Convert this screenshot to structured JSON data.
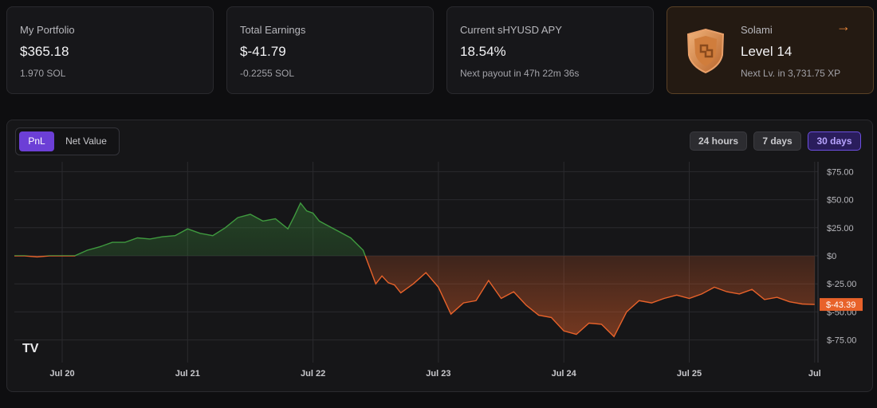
{
  "cards": {
    "portfolio": {
      "label": "My Portfolio",
      "value": "$365.18",
      "sub": "1.970 SOL"
    },
    "earnings": {
      "label": "Total Earnings",
      "value": "$-41.79",
      "sub": "-0.2255 SOL"
    },
    "apy": {
      "label": "Current sHYUSD APY",
      "value": "18.54%",
      "sub": "Next payout in 47h 22m 36s"
    },
    "level": {
      "label": "Solami",
      "value": "Level 14",
      "sub": "Next Lv. in 3,731.75 XP",
      "arrow": "→",
      "icon": "shield-badge-icon"
    }
  },
  "chart_panel": {
    "toggle": {
      "pnl": "PnL",
      "net_value": "Net Value",
      "selected": "PnL"
    },
    "ranges": [
      "24 hours",
      "7 days",
      "30 days"
    ],
    "selected_range": "30 days",
    "logo": "TV"
  },
  "colors": {
    "positive": "#3f9a3f",
    "negative": "#e8622a",
    "accent": "#6c3fd6",
    "background": "#0e0e10"
  },
  "chart_data": {
    "type": "area",
    "x_tick_labels": [
      "Jul 20",
      "Jul 21",
      "Jul 22",
      "Jul 23",
      "Jul 24",
      "Jul 25",
      "Jul"
    ],
    "y_tick_labels": [
      "$75.00",
      "$50.00",
      "$25.00",
      "$0",
      "$-25.00",
      "$-50.00",
      "$-75.00"
    ],
    "ylim": [
      -80,
      80
    ],
    "last_value_label": "$-43.39",
    "grid": true,
    "series": [
      {
        "x": [
          19.6,
          19.7,
          19.8,
          19.9,
          20.0,
          20.1,
          20.2,
          20.3,
          20.4,
          20.5,
          20.6,
          20.7,
          20.8,
          20.9,
          21.0,
          21.1,
          21.2,
          21.3,
          21.4,
          21.5,
          21.6,
          21.7,
          21.8,
          21.85,
          21.9,
          21.95,
          22.0,
          22.05,
          22.1,
          22.2,
          22.3,
          22.4,
          22.5,
          22.55,
          22.6,
          22.65,
          22.7,
          22.8,
          22.9,
          23.0,
          23.1,
          23.2,
          23.3,
          23.4,
          23.5,
          23.6,
          23.7,
          23.8,
          23.9,
          24.0,
          24.1,
          24.2,
          24.3,
          24.4,
          24.5,
          24.6,
          24.7,
          24.8,
          24.9,
          25.0,
          25.1,
          25.2,
          25.3,
          25.4,
          25.5,
          25.6,
          25.7,
          25.8,
          25.9,
          26.0
        ],
        "values": [
          0,
          0,
          -1,
          0,
          0,
          0,
          5,
          8,
          12,
          12,
          16,
          15,
          17,
          18,
          24,
          20,
          18,
          25,
          34,
          37,
          31,
          33,
          24,
          35,
          47,
          40,
          38,
          31,
          28,
          22,
          16,
          5,
          -25,
          -18,
          -24,
          -26,
          -33,
          -25,
          -15,
          -28,
          -52,
          -42,
          -40,
          -22,
          -38,
          -32,
          -44,
          -53,
          -55,
          -67,
          -70,
          -60,
          -61,
          -72,
          -50,
          -40,
          -42,
          -38,
          -35,
          -38,
          -34,
          -28,
          -32,
          -34,
          -30,
          -39,
          -37,
          -41,
          -43,
          -43.39
        ]
      }
    ]
  }
}
